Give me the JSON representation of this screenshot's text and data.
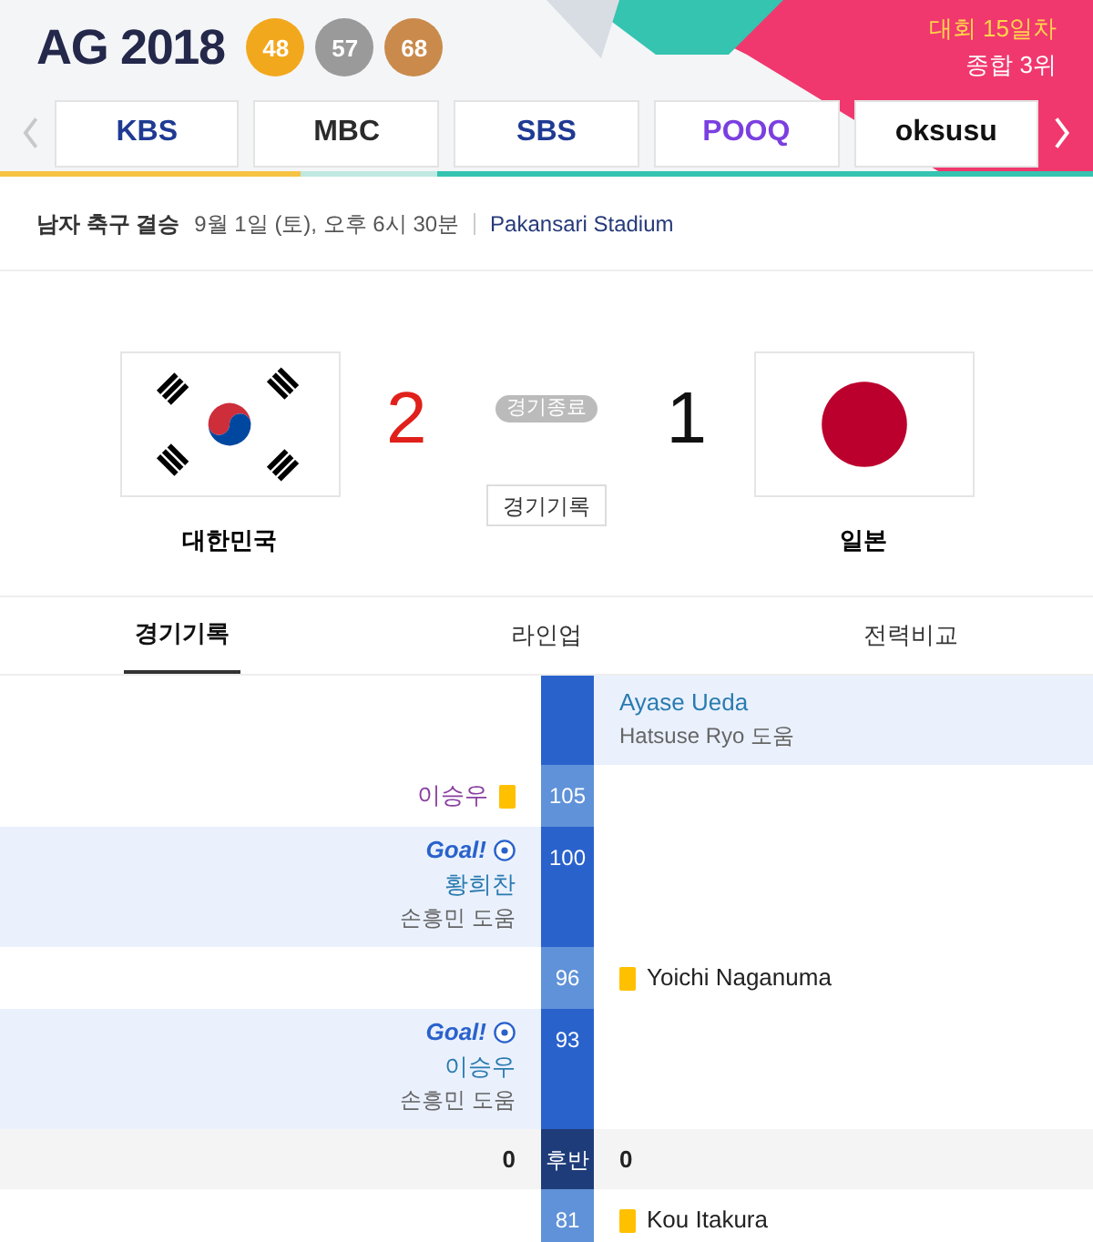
{
  "header": {
    "logo": "AG 2018",
    "medals": [
      {
        "count": "48",
        "color": "#f2a81d"
      },
      {
        "count": "57",
        "color": "#9a9a9a"
      },
      {
        "count": "68",
        "color": "#c98a4b"
      }
    ],
    "day": "대회 15일차",
    "rank": "종합 3위"
  },
  "broadcasters": [
    {
      "name": "KBS",
      "color": "#1f3a93"
    },
    {
      "name": "MBC",
      "color": "#2b2b2b"
    },
    {
      "name": "SBS",
      "color": "#1f3a93"
    },
    {
      "name": "POOQ",
      "color": "#7b3fe0"
    },
    {
      "name": "oksusu",
      "color": "#111111"
    }
  ],
  "match": {
    "event": "남자 축구 결승",
    "datetime": "9월 1일 (토), 오후 6시 30분",
    "venue": "Pakansari Stadium",
    "home": {
      "name": "대한민국",
      "score": "2"
    },
    "away": {
      "name": "일본",
      "score": "1"
    },
    "status": "경기종료",
    "record_button": "경기기록"
  },
  "tabs": [
    {
      "label": "경기기록",
      "selected": true
    },
    {
      "label": "라인업",
      "selected": false
    },
    {
      "label": "전력비교",
      "selected": false
    }
  ],
  "events": [
    {
      "kind": "goal",
      "away": {
        "player": "Ayase Ueda",
        "assist": "Hatsuse Ryo 도움"
      }
    },
    {
      "kind": "card",
      "minute": "105",
      "home": {
        "player": "이승우"
      }
    },
    {
      "kind": "goal",
      "minute": "100",
      "home": {
        "goal_label": "Goal!",
        "player": "황희찬",
        "assist": "손흥민 도움"
      }
    },
    {
      "kind": "card",
      "minute": "96",
      "away": {
        "player": "Yoichi Naganuma"
      }
    },
    {
      "kind": "goal",
      "minute": "93",
      "home": {
        "goal_label": "Goal!",
        "player": "이승우",
        "assist": "손흥민 도움"
      }
    },
    {
      "kind": "period",
      "minute": "후반",
      "home": {
        "score": "0"
      },
      "away": {
        "score": "0"
      }
    },
    {
      "kind": "card",
      "minute": "81",
      "away": {
        "player": "Kou Itakura"
      }
    }
  ]
}
